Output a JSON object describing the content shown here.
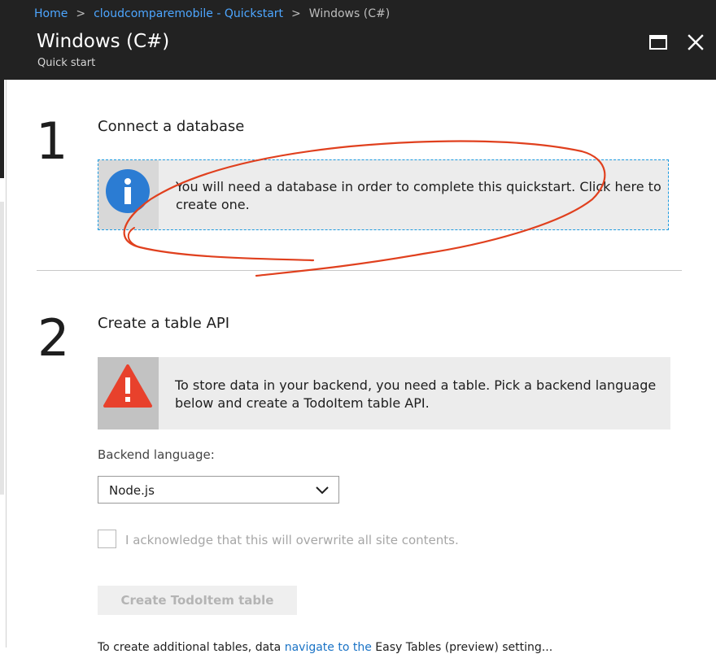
{
  "breadcrumb": {
    "home": "Home",
    "parent": "cloudcomparemobile - Quickstart",
    "current": "Windows (C#)",
    "separator": ">"
  },
  "blade": {
    "title": "Windows (C#)",
    "subtitle": "Quick start",
    "maximize_icon": "maximize-icon",
    "close_icon": "close-icon"
  },
  "step1": {
    "number": "1",
    "title": "Connect a database",
    "info_icon": "info-icon",
    "message_line1": "You will need a database in order to complete this quickstart. Click here to",
    "message_line2": "create one."
  },
  "step2": {
    "number": "2",
    "title": "Create a table API",
    "warning_icon": "warning-icon",
    "message_line1": "To store data in your backend, you need a table. Pick a backend language",
    "message_line2": "below and create a TodoItem table API.",
    "backend_label": "Backend language:",
    "backend_value": "Node.js",
    "acknowledge_label": "I acknowledge that this will overwrite all site contents.",
    "acknowledge_checked": false,
    "create_button": "Create TodoItem table",
    "create_button_enabled": false,
    "footer_text_start": "To create additional tables, data",
    "footer_link": "navigate to the",
    "footer_text_end": "Easy Tables (preview) setting..."
  },
  "colors": {
    "header_bg": "#222222",
    "link": "#4da6ff",
    "info_icon": "#2b7cd3",
    "warning_icon": "#e8412c",
    "annotation": "#e0401e"
  }
}
